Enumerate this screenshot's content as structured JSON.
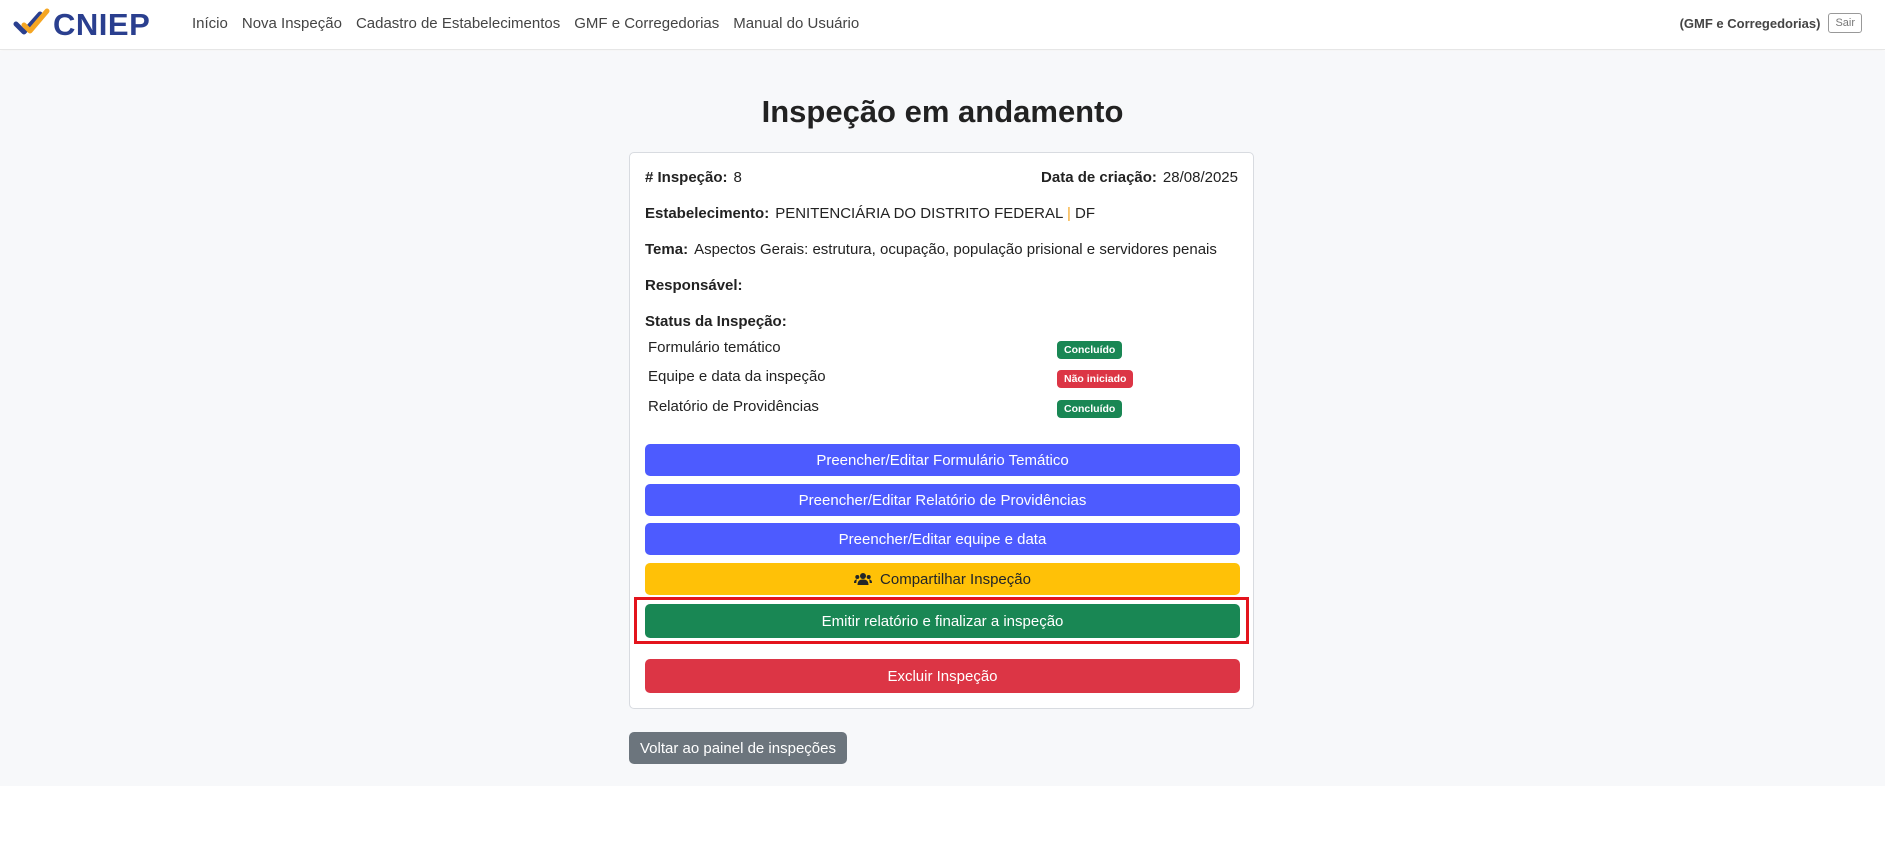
{
  "brand": {
    "name": "CNIEP"
  },
  "nav": {
    "items": [
      {
        "label": "Início"
      },
      {
        "label": "Nova Inspeção"
      },
      {
        "label": "Cadastro de Estabelecimentos"
      },
      {
        "label": "GMF e Corregedorias"
      },
      {
        "label": "Manual do Usuário"
      }
    ],
    "user_role": "(GMF e Corregedorias)",
    "logout_label": "Sair"
  },
  "page": {
    "title": "Inspeção em andamento"
  },
  "inspection": {
    "number_label": "# Inspeção:",
    "number_value": "8",
    "created_label": "Data de criação:",
    "created_value": "28/08/2025",
    "establishment_label": "Estabelecimento:",
    "establishment_value": "PENITENCIÁRIA DO DISTRITO FEDERAL",
    "establishment_sep": "|",
    "establishment_uf": "DF",
    "theme_label": "Tema:",
    "theme_value": "Aspectos Gerais: estrutura, ocupação, população prisional e servidores penais",
    "responsible_label": "Responsável:",
    "responsible_value": "",
    "status_label": "Status da Inspeção:",
    "status_items": [
      {
        "label": "Formulário temático",
        "status": "Concluído",
        "color": "#198754"
      },
      {
        "label": "Equipe e data da inspeção",
        "status": "Não iniciado",
        "color": "#dc3545"
      },
      {
        "label": "Relatório de Providências",
        "status": "Concluído",
        "color": "#198754"
      }
    ]
  },
  "actions": {
    "fill_form": "Preencher/Editar Formulário Temático",
    "fill_report": "Preencher/Editar Relatório de Providências",
    "fill_team": "Preencher/Editar equipe e data",
    "share": "Compartilhar Inspeção",
    "issue_report": "Emitir relatório e finalizar a inspeção",
    "delete": "Excluir Inspeção",
    "back": "Voltar ao painel de inspeções"
  },
  "colors": {
    "primary": "#4d5bff",
    "warning": "#ffc107",
    "success": "#198754",
    "danger": "#dc3545",
    "secondary": "#6c757d",
    "highlight": "#e3141d",
    "brand": "#2a3f8f",
    "brand_accent": "#f5a623"
  },
  "icons": {
    "share": "users-icon",
    "logo": "checkmark-logo-icon"
  }
}
